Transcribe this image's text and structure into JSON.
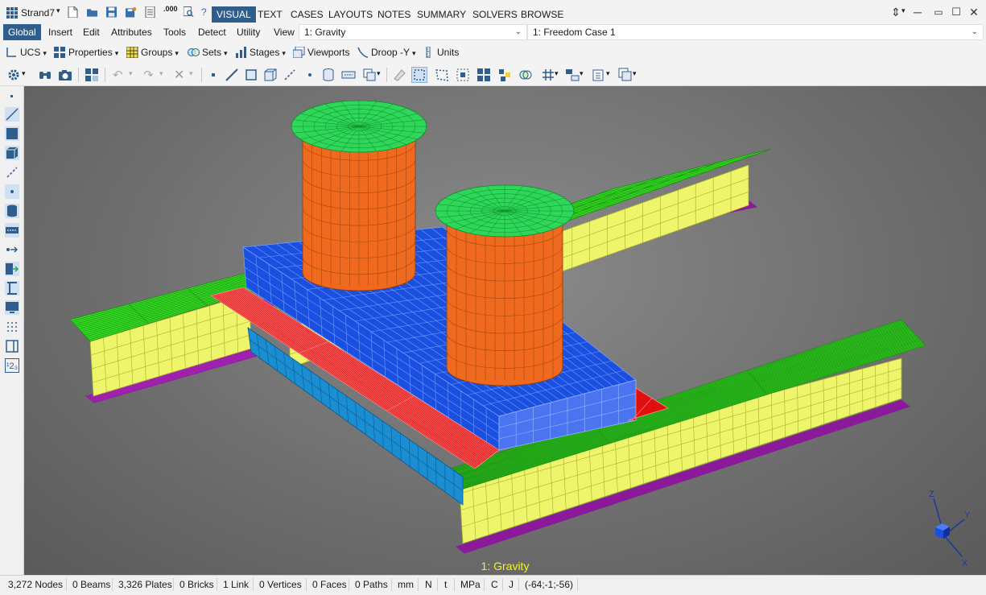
{
  "app": {
    "title": "Strand7"
  },
  "ribbon_tabs": [
    {
      "label": "VISUAL",
      "active": true
    },
    {
      "label": "TEXT"
    },
    {
      "label": "CASES"
    },
    {
      "label": "LAYOUTS"
    },
    {
      "label": "NOTES"
    },
    {
      "label": "SUMMARY"
    },
    {
      "label": "SOLVERS"
    },
    {
      "label": "BROWSE"
    }
  ],
  "menu": [
    {
      "label": "Global",
      "active": true
    },
    {
      "label": "Insert"
    },
    {
      "label": "Edit"
    },
    {
      "label": "Attributes"
    },
    {
      "label": "Tools"
    },
    {
      "label": "Detect"
    },
    {
      "label": "Utility"
    },
    {
      "label": "View"
    }
  ],
  "load_case": "1: Gravity",
  "freedom_case": "1: Freedom Case 1",
  "toolbar1": {
    "ucs": "UCS",
    "properties": "Properties",
    "groups": "Groups",
    "sets": "Sets",
    "stages": "Stages",
    "viewports": "Viewports",
    "droop": "Droop -Y",
    "units": "Units"
  },
  "viewport": {
    "case_label": "1: Gravity",
    "axis_labels": {
      "z": "Z",
      "y": "Y",
      "x": "X"
    },
    "colors": {
      "background": "#707070",
      "flange_top": "#33dd22",
      "web": "#eef56a",
      "bottom_flange": "#cc33dd",
      "base_block": "#1b4fe0",
      "red_plates": "#e01010",
      "cyan_side": "#1a8ed0",
      "cylinder": "#ef6a1e",
      "cap": "#2ed65a"
    }
  },
  "status": {
    "nodes": "3,272 Nodes",
    "beams": "0 Beams",
    "plates": "3,326 Plates",
    "bricks": "0 Bricks",
    "links": "1 Link",
    "vertices": "0 Vertices",
    "faces": "0 Faces",
    "paths": "0 Paths",
    "length_unit": "mm",
    "force_unit": "N",
    "time_unit": "t",
    "stress_unit": "MPa",
    "temp_unit": "C",
    "energy_unit": "J",
    "view_angles": "(-64;-1;-56)"
  }
}
